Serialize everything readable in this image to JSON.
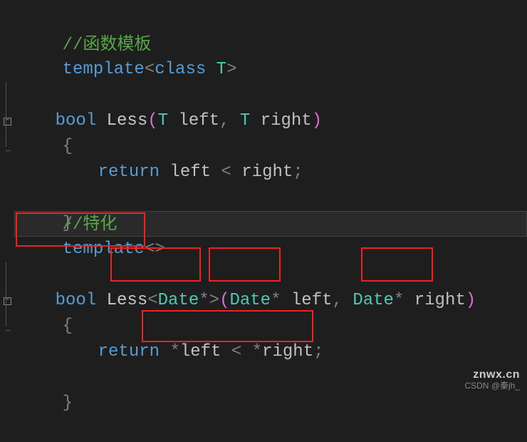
{
  "code": {
    "line1_comment_slash": "//",
    "line1_comment_zh": "函数模板",
    "line2_template": "template",
    "line2_lt": "<",
    "line2_class": "class ",
    "line2_T": "T",
    "line2_gt": ">",
    "line3_bool": "bool ",
    "line3_less": "Less",
    "line3_lparen": "(",
    "line3_T1": "T ",
    "line3_left": "left",
    "line3_comma": ", ",
    "line3_T2": "T ",
    "line3_right": "right",
    "line3_rparen": ")",
    "line4_lbrace": "{",
    "line5_return": "return ",
    "line5_left": "left ",
    "line5_lt": "< ",
    "line5_right": "right",
    "line5_semi": ";",
    "line6_rbrace": "}",
    "line8_comment_slash": "//",
    "line8_comment_zh": "特化",
    "line9_template": "template",
    "line9_lt": "<",
    "line9_gt": ">",
    "line10_bool": "bool ",
    "line10_less": "Less",
    "line10_lt": "<",
    "line10_date1": "Date",
    "line10_star1": "*",
    "line10_gt": ">",
    "line10_lparen": "(",
    "line10_date2": "Date",
    "line10_star2": "* ",
    "line10_left": "left",
    "line10_comma": ", ",
    "line10_date3": "Date",
    "line10_star3": "* ",
    "line10_right": "right",
    "line10_rparen": ")",
    "line11_lbrace": "{",
    "line12_return": "return ",
    "line12_star1": "*",
    "line12_left": "left ",
    "line12_lt": "< ",
    "line12_star2": "*",
    "line12_right": "right",
    "line12_semi": ";",
    "line13_rbrace": "}"
  },
  "watermark_main": "znwx.cn",
  "watermark_sub": "CSDN @秦jh_"
}
